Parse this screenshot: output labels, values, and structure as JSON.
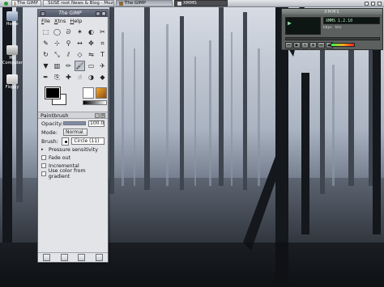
{
  "taskbar": {
    "tasks": [
      {
        "label": "The GIMP",
        "state": "normal"
      },
      {
        "label": "SUSE root News & Blog - Mozi",
        "state": "normal"
      },
      {
        "label": "The GIMP",
        "state": "active"
      },
      {
        "label": "XMMS",
        "state": "dark"
      }
    ]
  },
  "desktop_icons": [
    {
      "label": "Home"
    },
    {
      "label": "My Computer"
    },
    {
      "label": "Floppy"
    }
  ],
  "toolbox": {
    "title": "The GIMP",
    "menus": [
      "File",
      "Xtns",
      "Help"
    ],
    "tools": [
      "rect-select-icon",
      "ellipse-select-icon",
      "lasso-icon",
      "magic-wand-icon",
      "color-select-icon",
      "scissors-icon",
      "paths-icon",
      "color-picker-icon",
      "zoom-icon",
      "measure-icon",
      "move-icon",
      "crop-icon",
      "rotate-icon",
      "scale-icon",
      "shear-icon",
      "perspective-icon",
      "flip-icon",
      "text-icon",
      "bucket-fill-icon",
      "blend-icon",
      "pencil-icon",
      "paintbrush-icon",
      "eraser-icon",
      "airbrush-icon",
      "ink-icon",
      "clone-icon",
      "heal-icon",
      "smudge-icon",
      "dodge-burn-icon",
      "convolve-icon"
    ],
    "tool_glyphs": [
      "⬚",
      "◯",
      "ᘐ",
      "✶",
      "◐",
      "✂",
      "✎",
      "⊹",
      "⚲",
      "↔",
      "✥",
      "⌗",
      "↻",
      "⤡",
      "⫽",
      "◇",
      "⇋",
      "T",
      "▼",
      "▥",
      "✏",
      "🖌",
      "▭",
      "✈",
      "✒",
      "⎘",
      "✚",
      "☝",
      "◑",
      "◆"
    ],
    "selected_tool_index": 21,
    "foreground_color": "#000000",
    "background_color": "#ffffff"
  },
  "tool_options": {
    "title": "Paintbrush",
    "opacity_label": "Opacity:",
    "opacity_value": "100.0",
    "opacity_fraction": 1.0,
    "mode_label": "Mode:",
    "mode_value": "Normal",
    "brush_label": "Brush:",
    "brush_value": "Circle (11)",
    "pressure_label": "Pressure sensitivity",
    "options": [
      "Fade out",
      "Incremental",
      "Use color from gradient"
    ]
  },
  "xmms": {
    "title": "XMMS",
    "marquee": "XMMS 1.2.10",
    "kbps": "kbps",
    "khz": "khz",
    "controls": [
      "⏮",
      "▶",
      "⏸",
      "⏹",
      "⏭",
      "⏏"
    ]
  }
}
